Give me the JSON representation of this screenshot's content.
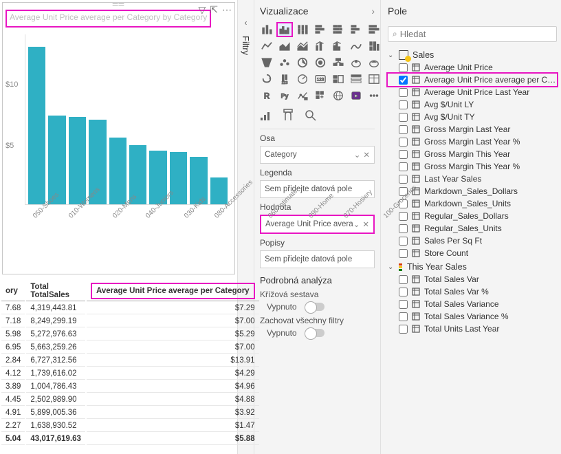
{
  "colors": {
    "accent": "#e815c2",
    "bar": "#2fb0c4"
  },
  "chart_data": {
    "type": "bar",
    "title": "Average Unit Price average per Category by Category",
    "xlabel": "",
    "ylabel": "",
    "ylim": [
      0,
      14
    ],
    "y_ticks": [
      "$10",
      "$5"
    ],
    "categories": [
      "050-Shoes",
      "010-Womens",
      "020-Mens",
      "040-Juniors",
      "030-Kids",
      "080-Accessories",
      "060-Intimate",
      "090-Home",
      "070-Hosiery",
      "100-Groceries"
    ],
    "values": [
      13.0,
      7.3,
      7.2,
      7.0,
      5.5,
      4.9,
      4.4,
      4.3,
      3.9,
      2.2
    ]
  },
  "table": {
    "col_ory": "ory",
    "col_val1": "7.68",
    "col_total_header_line1": "Total",
    "col_total_header_line2": "TotalSales",
    "col_avg_header": "Average Unit Price average per Category",
    "rows": [
      {
        "c0": "7.68",
        "ts": "4,319,443.81",
        "avg": "$7.29"
      },
      {
        "c0": "7.18",
        "ts": "8,249,299.19",
        "avg": "$7.00"
      },
      {
        "c0": "5.98",
        "ts": "5,272,976.63",
        "avg": "$5.29"
      },
      {
        "c0": "6.95",
        "ts": "5,663,259.26",
        "avg": "$7.00"
      },
      {
        "c0": "2.84",
        "ts": "6,727,312.56",
        "avg": "$13.91"
      },
      {
        "c0": "4.12",
        "ts": "1,739,616.02",
        "avg": "$4.29"
      },
      {
        "c0": "3.89",
        "ts": "1,004,786.43",
        "avg": "$4.96"
      },
      {
        "c0": "4.45",
        "ts": "2,502,989.90",
        "avg": "$4.88"
      },
      {
        "c0": "4.91",
        "ts": "5,899,005.36",
        "avg": "$3.92"
      },
      {
        "c0": "2.27",
        "ts": "1,638,930.52",
        "avg": "$1.47"
      }
    ],
    "grand": {
      "c0": "5.04",
      "ts": "43,017,619.63",
      "avg": "$5.88"
    }
  },
  "filters_tab": "Filtry",
  "viz_pane": {
    "title": "Vizualizace",
    "section_axis": "Osa",
    "axis_field": "Category",
    "section_legend": "Legenda",
    "legend_placeholder": "Sem přidejte datová pole",
    "section_value": "Hodnota",
    "value_field": "Average Unit Price avera",
    "section_tooltip": "Popisy",
    "tooltip_placeholder": "Sem přidejte datová pole",
    "drill_header": "Podrobná analýza",
    "cross_label": "Křížová sestava",
    "off_label": "Vypnuto",
    "keep_label": "Zachovat všechny filtry"
  },
  "fields_pane": {
    "title": "Pole",
    "search_placeholder": "Hledat",
    "table_sales": "Sales",
    "table_this_year": "This Year Sales",
    "fields_sales": [
      {
        "name": "Average Unit Price",
        "checked": false,
        "sel": false
      },
      {
        "name": "Average Unit Price average per Cate...",
        "checked": true,
        "sel": true
      },
      {
        "name": "Average Unit Price Last Year",
        "checked": false,
        "sel": false
      },
      {
        "name": "Avg $/Unit LY",
        "checked": false,
        "sel": false
      },
      {
        "name": "Avg $/Unit TY",
        "checked": false,
        "sel": false
      },
      {
        "name": "Gross Margin Last Year",
        "checked": false,
        "sel": false
      },
      {
        "name": "Gross Margin Last Year %",
        "checked": false,
        "sel": false
      },
      {
        "name": "Gross Margin This Year",
        "checked": false,
        "sel": false
      },
      {
        "name": "Gross Margin This Year %",
        "checked": false,
        "sel": false
      },
      {
        "name": "Last Year Sales",
        "checked": false,
        "sel": false
      },
      {
        "name": "Markdown_Sales_Dollars",
        "checked": false,
        "sel": false
      },
      {
        "name": "Markdown_Sales_Units",
        "checked": false,
        "sel": false
      },
      {
        "name": "Regular_Sales_Dollars",
        "checked": false,
        "sel": false
      },
      {
        "name": "Regular_Sales_Units",
        "checked": false,
        "sel": false
      },
      {
        "name": "Sales Per Sq Ft",
        "checked": false,
        "sel": false
      },
      {
        "name": "Store Count",
        "checked": false,
        "sel": false
      }
    ],
    "fields_year": [
      {
        "name": "Total Sales Var",
        "checked": false
      },
      {
        "name": "Total Sales Var %",
        "checked": false
      },
      {
        "name": "Total Sales Variance",
        "checked": false
      },
      {
        "name": "Total Sales Variance %",
        "checked": false
      },
      {
        "name": "Total Units Last Year",
        "checked": false
      }
    ]
  }
}
